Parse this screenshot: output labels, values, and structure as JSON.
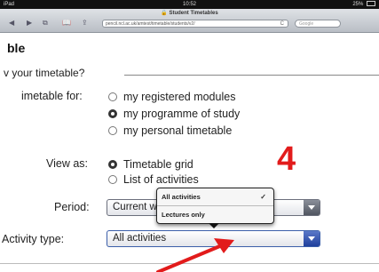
{
  "status_bar": {
    "carrier": "iPad",
    "time": "10:52",
    "battery": "25%"
  },
  "browser": {
    "page_title": "Student Timetables",
    "url": "pencil.ncl.ac.uk/amtest/timetable/students/v2/",
    "search_placeholder": "Google",
    "icons": {
      "back": "◀",
      "forward": "▶",
      "bookmarks": "⧉",
      "reading": "📖",
      "share": "⇪",
      "reload": "C"
    }
  },
  "page": {
    "heading": "ble",
    "fieldset_legend": "v your timetable?",
    "timetable_for": {
      "label": "imetable for:",
      "options": [
        "my registered modules",
        "my programme of study",
        "my personal timetable"
      ],
      "selected": 1
    },
    "view_as": {
      "label": "View as:",
      "options": [
        "Timetable grid",
        "List of activities"
      ],
      "selected": 0
    },
    "period": {
      "label": "Period:",
      "value": "Current w"
    },
    "activity_type": {
      "label": "Activity type:",
      "value": "All activities"
    },
    "popover": {
      "options": [
        "All activities",
        "Lectures only"
      ],
      "selected": 0,
      "check": "✓"
    },
    "annotation_number": "4",
    "annotation_color": "#e21b1b"
  }
}
